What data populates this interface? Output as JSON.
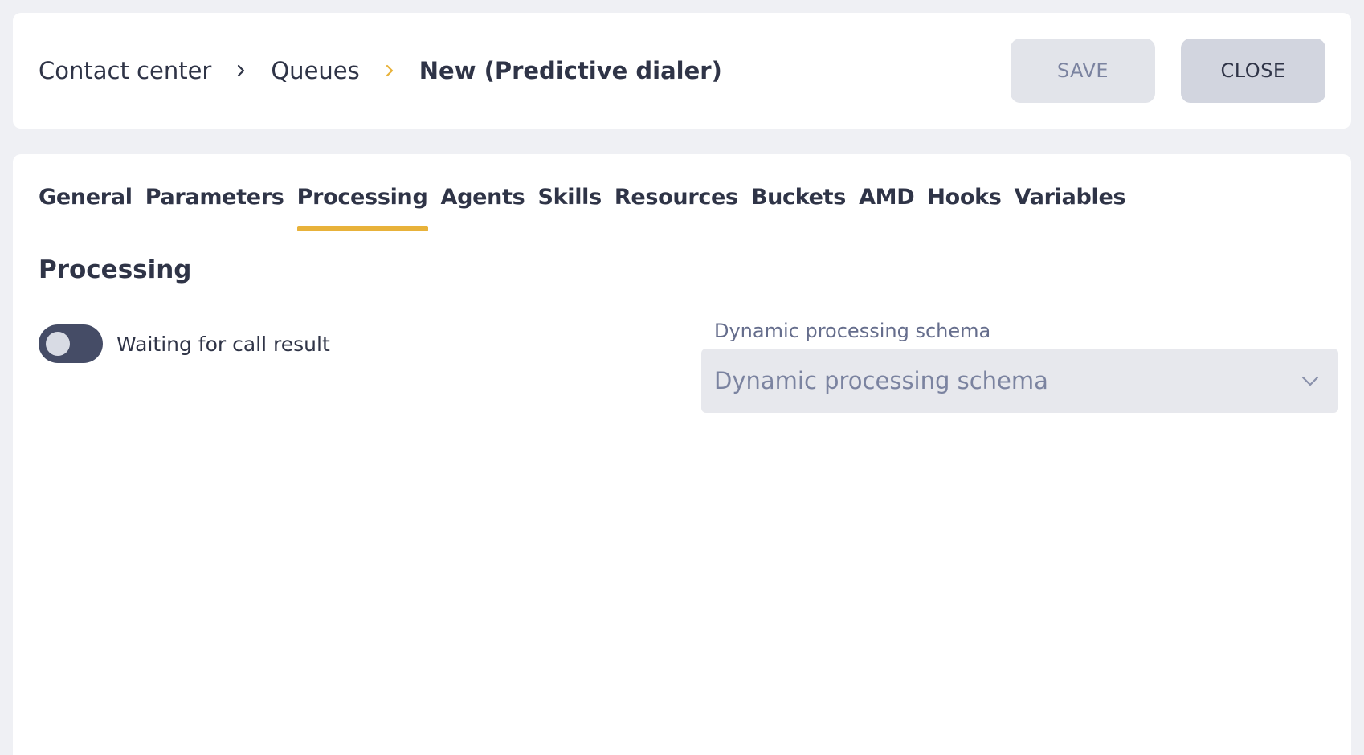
{
  "breadcrumb": {
    "items": [
      "Contact center",
      "Queues"
    ],
    "current": "New (Predictive dialer)"
  },
  "header": {
    "save_label": "SAVE",
    "close_label": "CLOSE"
  },
  "tabs": [
    {
      "label": "General"
    },
    {
      "label": "Parameters"
    },
    {
      "label": "Processing",
      "active": true
    },
    {
      "label": "Agents"
    },
    {
      "label": "Skills"
    },
    {
      "label": "Resources"
    },
    {
      "label": "Buckets"
    },
    {
      "label": "AMD"
    },
    {
      "label": "Hooks"
    },
    {
      "label": "Variables"
    }
  ],
  "section": {
    "title": "Processing"
  },
  "toggle": {
    "label": "Waiting for call result",
    "on": false
  },
  "schema_field": {
    "label": "Dynamic processing schema",
    "placeholder": "Dynamic processing schema"
  },
  "colors": {
    "accent": "#e8b23a",
    "text": "#2f3447",
    "muted": "#7b83a0",
    "background": "#eff0f4"
  },
  "icons": {
    "breadcrumb_separator": "chevron-right-icon",
    "select_arrow": "chevron-down-icon"
  }
}
